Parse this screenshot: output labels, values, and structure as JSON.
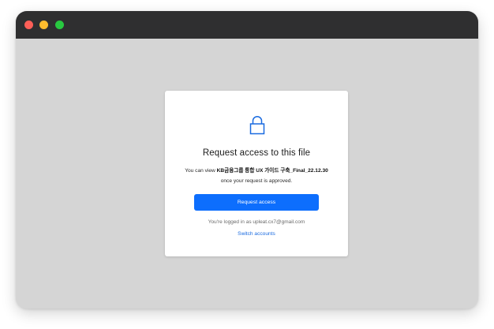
{
  "window": {
    "controls": [
      "close",
      "minimize",
      "maximize"
    ],
    "colors": {
      "titlebar": "#2f2f30",
      "close": "#fe5f57",
      "minimize": "#febc2e",
      "maximize": "#28c840",
      "background": "#d5d5d5"
    }
  },
  "dialog": {
    "icon": "lock-icon",
    "title": "Request access to this file",
    "desc_prefix": "You can view ",
    "file_name": "KB금융그룹 통합 UX 가이드 구축_Final_22.12.30",
    "desc_suffix": " once your request is approved.",
    "button_label": "Request access",
    "logged_in_text": "You're logged in as upleat.cx7@gmail.com",
    "switch_label": "Switch accounts",
    "accent_color": "#0d6efd"
  }
}
